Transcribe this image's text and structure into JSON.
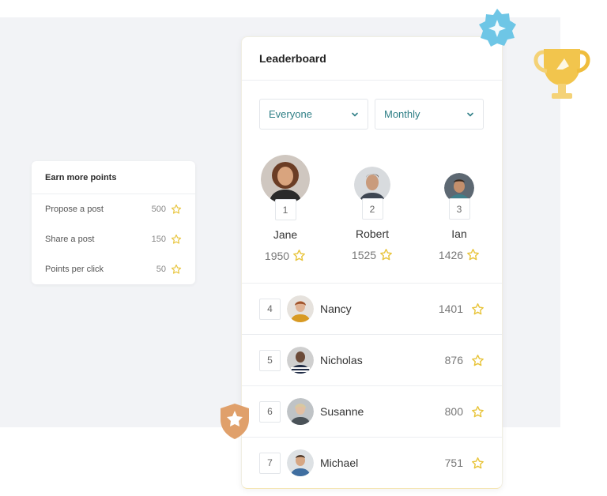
{
  "earn_points": {
    "title": "Earn more points",
    "items": [
      {
        "label": "Propose a post",
        "points": "500"
      },
      {
        "label": "Share a post",
        "points": "150"
      },
      {
        "label": "Points per click",
        "points": "50"
      }
    ]
  },
  "leaderboard": {
    "title": "Leaderboard",
    "filters": {
      "audience": "Everyone",
      "period": "Monthly"
    },
    "podium": [
      {
        "rank": "1",
        "name": "Jane",
        "score": "1950"
      },
      {
        "rank": "2",
        "name": "Robert",
        "score": "1525"
      },
      {
        "rank": "3",
        "name": "Ian",
        "score": "1426"
      }
    ],
    "rows": [
      {
        "rank": "4",
        "name": "Nancy",
        "score": "1401"
      },
      {
        "rank": "5",
        "name": "Nicholas",
        "score": "876"
      },
      {
        "rank": "6",
        "name": "Susanne",
        "score": "800"
      },
      {
        "rank": "7",
        "name": "Michael",
        "score": "751"
      }
    ]
  },
  "colors": {
    "accent": "#2f7f86",
    "star": "#e8c43a",
    "background": "#f2f3f6"
  }
}
